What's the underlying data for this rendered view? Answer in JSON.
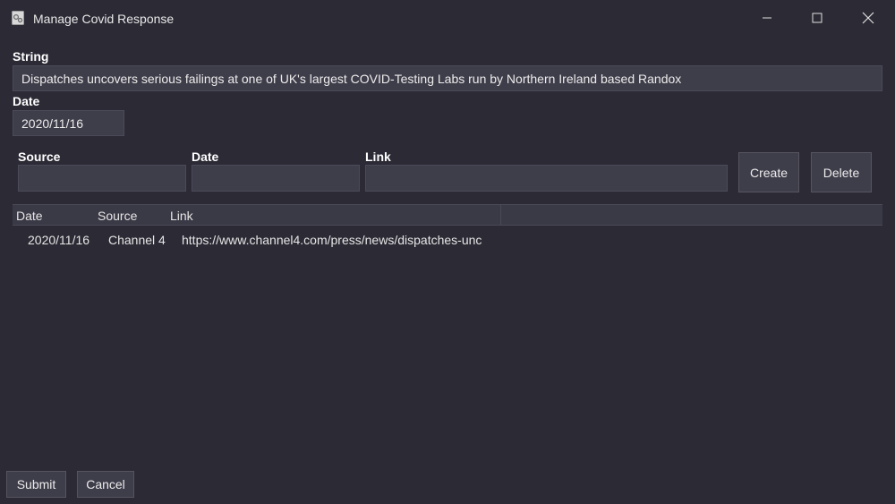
{
  "window": {
    "title": "Manage Covid Response",
    "icons": [
      "app-icon",
      "minimize-icon",
      "maximize-icon",
      "close-icon"
    ]
  },
  "form": {
    "string_label": "String",
    "string_value": "Dispatches uncovers serious failings at one of UK's largest COVID-Testing Labs run by Northern Ireland based Randox",
    "date_label": "Date",
    "date_value": "2020/11/16"
  },
  "source_form": {
    "source_label": "Source",
    "source_value": "",
    "date_label": "Date",
    "date_value": "",
    "link_label": "Link",
    "link_value": "",
    "create_label": "Create",
    "delete_label": "Delete"
  },
  "table": {
    "columns": [
      "Date",
      "Source",
      "Link"
    ],
    "rows": [
      {
        "date": "2020/11/16",
        "source": "Channel 4",
        "link": "https://www.channel4.com/press/news/dispatches-unc"
      }
    ]
  },
  "footer": {
    "submit_label": "Submit",
    "cancel_label": "Cancel"
  },
  "colors": {
    "background": "#2b2a35",
    "field": "#3e3d4a",
    "text": "#e6e6e6"
  }
}
